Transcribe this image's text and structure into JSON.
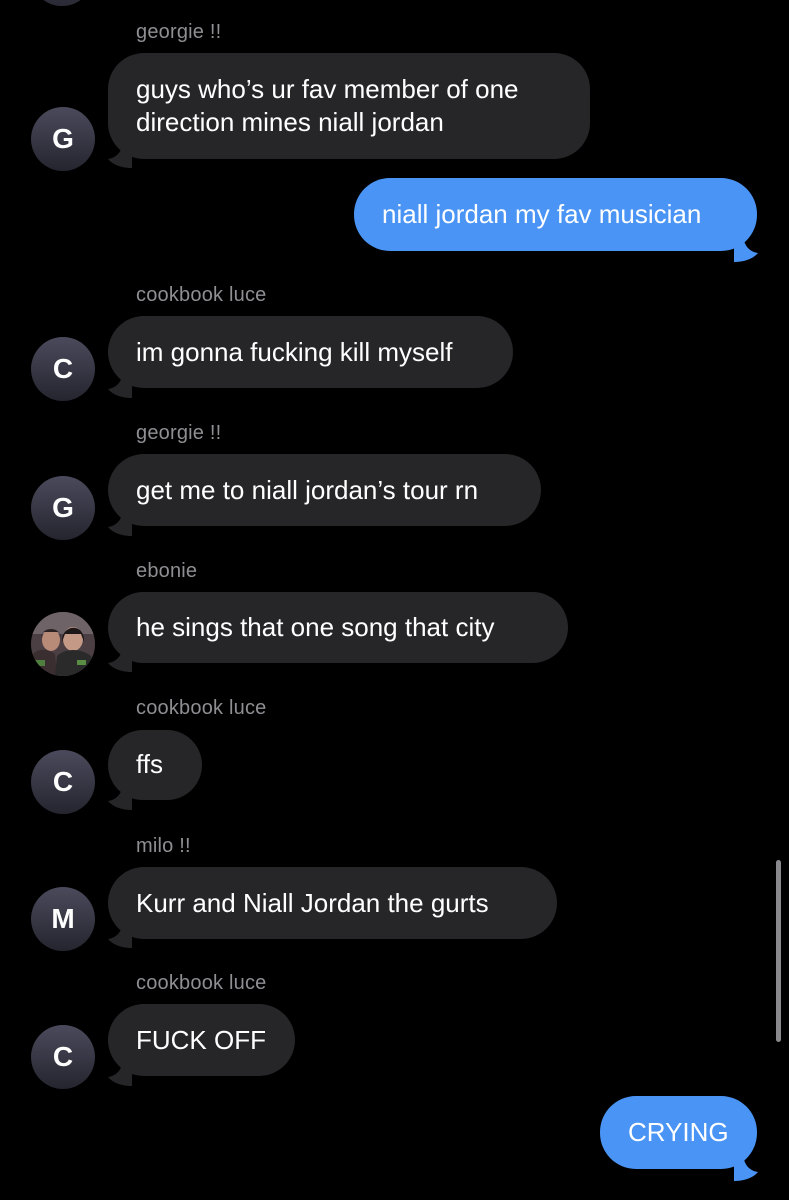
{
  "colors": {
    "background": "#000000",
    "incoming_bubble": "#262629",
    "outgoing_bubble": "#4a94f5",
    "sender_name": "#8e8e93",
    "avatar_gradient_top": "#4a4a5c",
    "avatar_gradient_bottom": "#25252f"
  },
  "messages": [
    {
      "direction": "incoming",
      "sender": "georgie !!",
      "avatar_initial": "G",
      "lines": [
        "guys who’s ur fav member of one",
        "direction mines niall jordan"
      ]
    },
    {
      "direction": "outgoing",
      "text": "niall jordan my fav musician"
    },
    {
      "direction": "incoming",
      "sender": "cookbook luce",
      "avatar_initial": "C",
      "text": "im gonna fucking kill myself"
    },
    {
      "direction": "incoming",
      "sender": "georgie !!",
      "avatar_initial": "G",
      "text": "get me to niall jordan’s tour rn"
    },
    {
      "direction": "incoming",
      "sender": "ebonie",
      "avatar_icon": "profile-photo",
      "text": "he sings that one song that city"
    },
    {
      "direction": "incoming",
      "sender": "cookbook luce",
      "avatar_initial": "C",
      "text": "ffs"
    },
    {
      "direction": "incoming",
      "sender": "milo !!",
      "avatar_initial": "M",
      "text": "Kurr and Niall Jordan the gurts"
    },
    {
      "direction": "incoming",
      "sender": "cookbook luce",
      "avatar_initial": "C",
      "text": "FUCK OFF"
    },
    {
      "direction": "outgoing",
      "text": "CRYING"
    }
  ]
}
